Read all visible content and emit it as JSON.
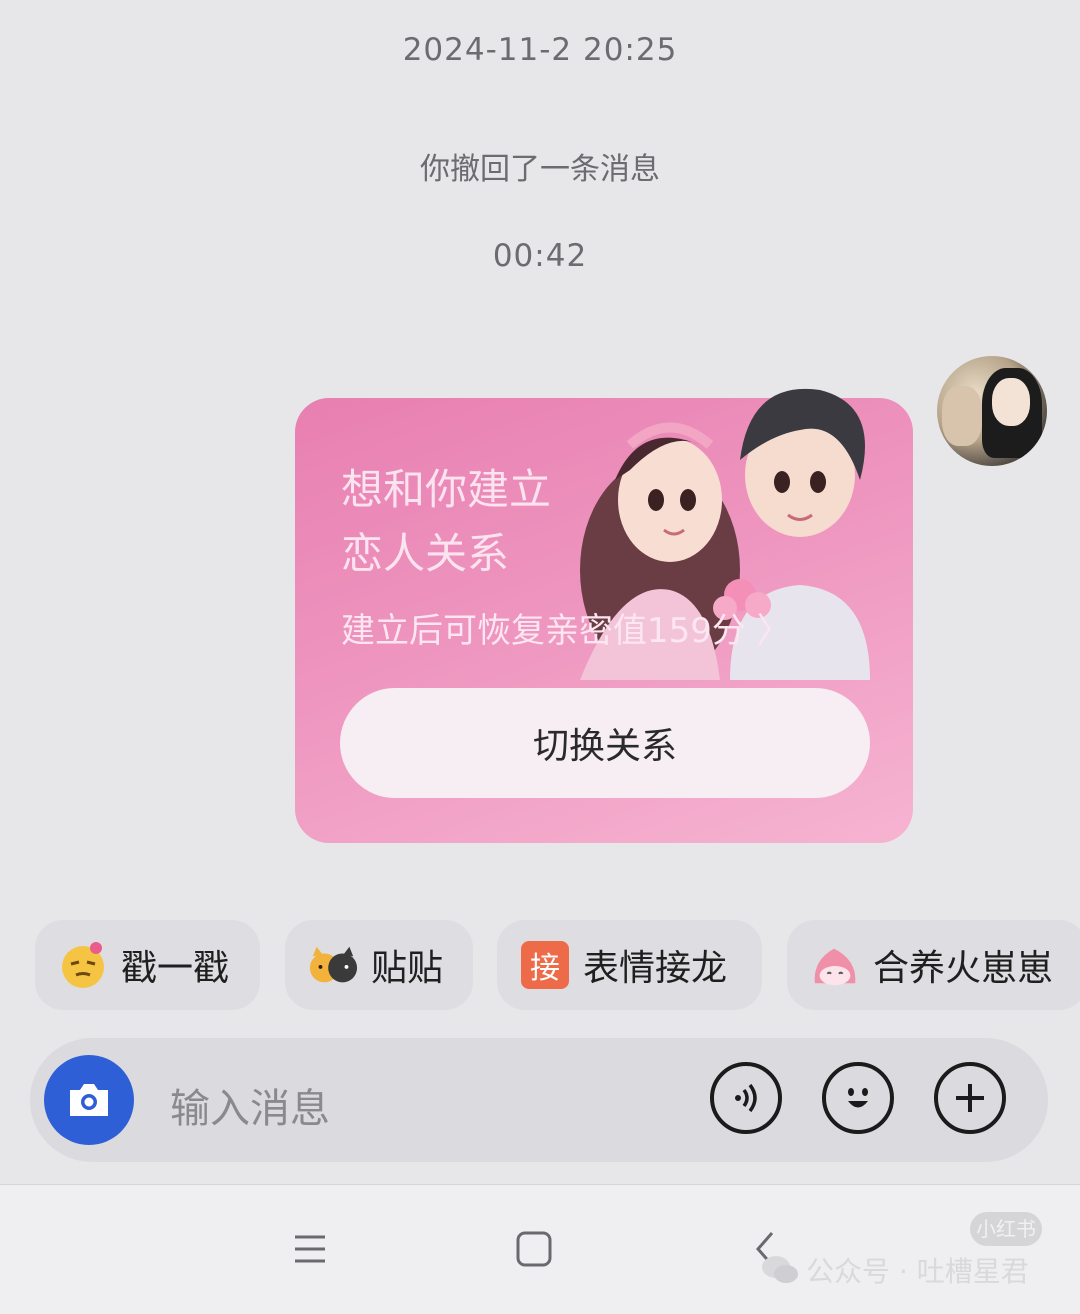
{
  "chat": {
    "timestamp_1": "2024-11-2 20:25",
    "recall_notice": "你撤回了一条消息",
    "timestamp_2": "00:42"
  },
  "card": {
    "title_line1": "想和你建立",
    "title_line2": "恋人关系",
    "subtitle": "建立后可恢复亲密值159分 〉",
    "button_label": "切换关系"
  },
  "quick_actions": [
    {
      "label": "戳一戳",
      "icon": "poke-emoji-icon"
    },
    {
      "label": "贴贴",
      "icon": "cats-hug-icon"
    },
    {
      "label": "表情接龙",
      "icon": "emoji-chain-icon",
      "icon_text": "接"
    },
    {
      "label": "合养火崽崽",
      "icon": "fire-pet-icon"
    }
  ],
  "input": {
    "placeholder": "输入消息"
  },
  "watermark": {
    "text": "公众号 · 吐槽星君",
    "badge": "小红书"
  },
  "colors": {
    "accent_blue": "#2f5fd6",
    "card_pink": "#ee95bf",
    "background": "#e7e7e9"
  }
}
